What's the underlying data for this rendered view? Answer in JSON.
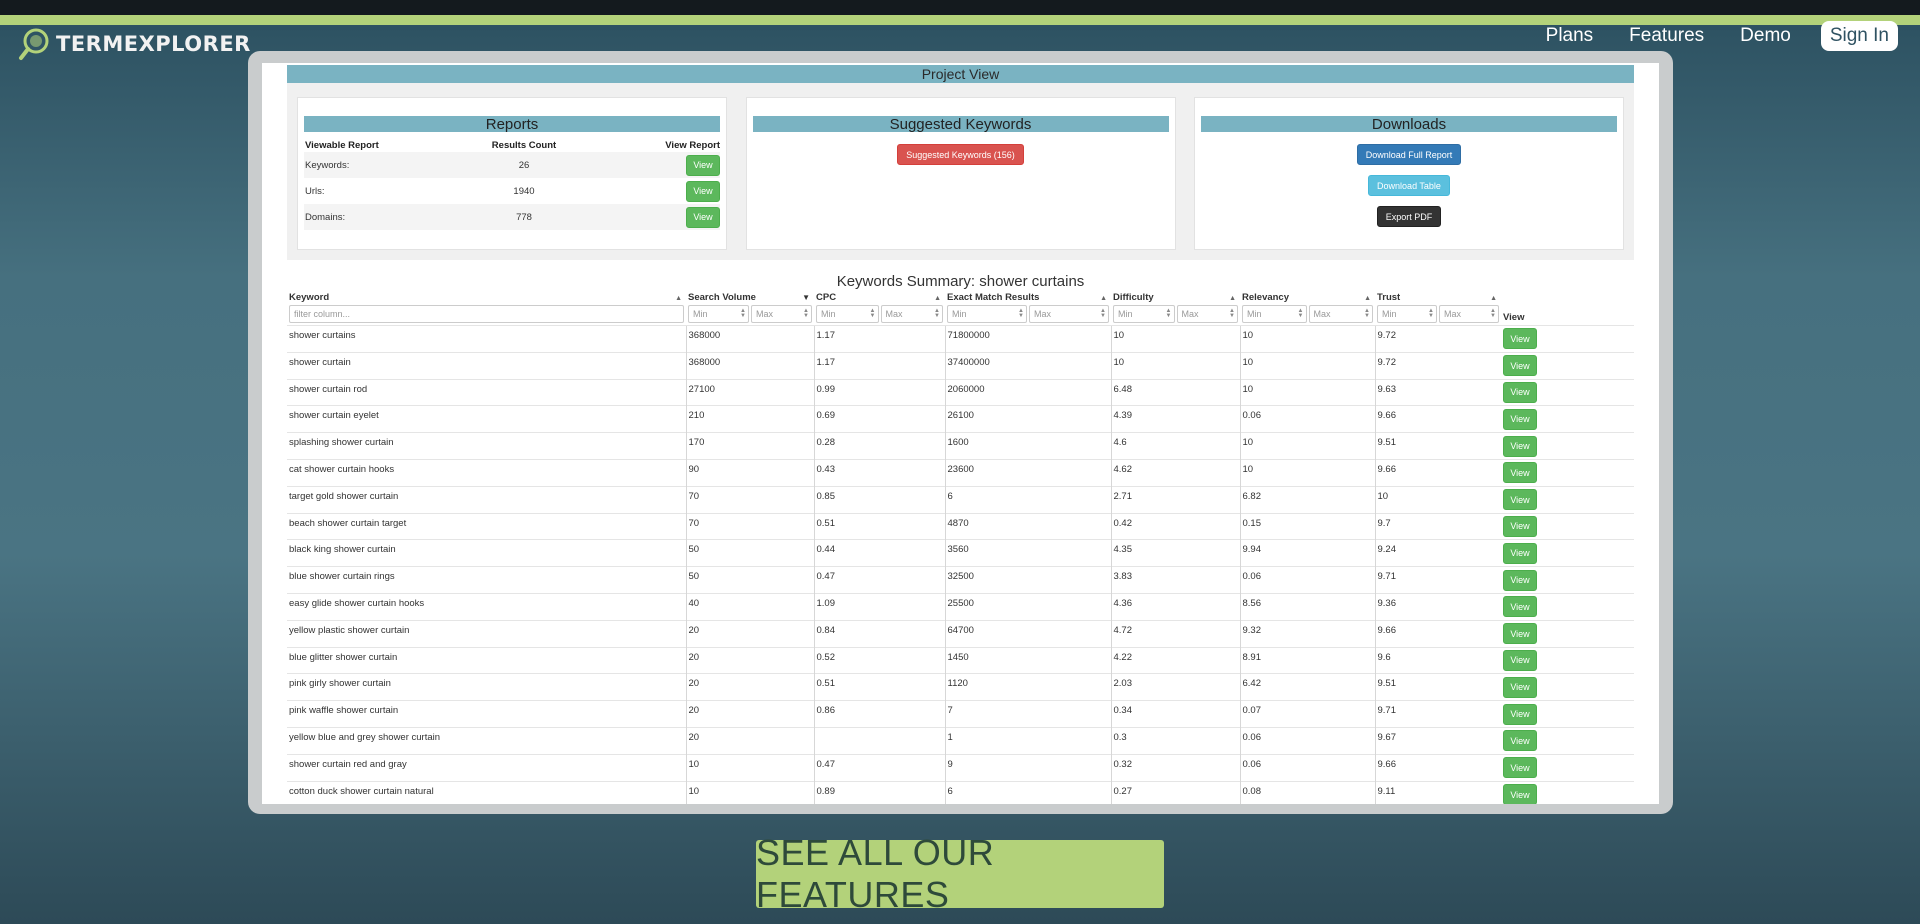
{
  "brand": {
    "logo_text": "TERMEXPLORER"
  },
  "nav": {
    "plans": "Plans",
    "features": "Features",
    "demo": "Demo",
    "sign_in": "Sign In"
  },
  "project_view": {
    "title": "Project View"
  },
  "reports": {
    "title": "Reports",
    "headers": [
      "Viewable Report",
      "Results Count",
      "View Report"
    ],
    "rows": [
      {
        "label": "Keywords:",
        "count": "26",
        "button": "View"
      },
      {
        "label": "Urls:",
        "count": "1940",
        "button": "View"
      },
      {
        "label": "Domains:",
        "count": "778",
        "button": "View"
      }
    ]
  },
  "suggested": {
    "title": "Suggested Keywords",
    "button": "Suggested Keywords (156)"
  },
  "downloads": {
    "title": "Downloads",
    "full_report": "Download Full Report",
    "table": "Download Table",
    "pdf": "Export PDF"
  },
  "summary": {
    "title": "Keywords Summary: shower curtains",
    "columns": [
      "Keyword",
      "Search Volume",
      "CPC",
      "Exact Match Results",
      "Difficulty",
      "Relevancy",
      "Trust",
      "View"
    ],
    "filter_placeholder": "filter column...",
    "min_placeholder": "Min",
    "max_placeholder": "Max",
    "view_label": "View",
    "rows": [
      [
        "shower curtains",
        "368000",
        "1.17",
        "71800000",
        "10",
        "10",
        "9.72"
      ],
      [
        "shower curtain",
        "368000",
        "1.17",
        "37400000",
        "10",
        "10",
        "9.72"
      ],
      [
        "shower curtain rod",
        "27100",
        "0.99",
        "2060000",
        "6.48",
        "10",
        "9.63"
      ],
      [
        "shower curtain eyelet",
        "210",
        "0.69",
        "26100",
        "4.39",
        "0.06",
        "9.66"
      ],
      [
        "splashing shower curtain",
        "170",
        "0.28",
        "1600",
        "4.6",
        "10",
        "9.51"
      ],
      [
        "cat shower curtain hooks",
        "90",
        "0.43",
        "23600",
        "4.62",
        "10",
        "9.66"
      ],
      [
        "target gold shower curtain",
        "70",
        "0.85",
        "6",
        "2.71",
        "6.82",
        "10"
      ],
      [
        "beach shower curtain target",
        "70",
        "0.51",
        "4870",
        "0.42",
        "0.15",
        "9.7"
      ],
      [
        "black king shower curtain",
        "50",
        "0.44",
        "3560",
        "4.35",
        "9.94",
        "9.24"
      ],
      [
        "blue shower curtain rings",
        "50",
        "0.47",
        "32500",
        "3.83",
        "0.06",
        "9.71"
      ],
      [
        "easy glide shower curtain hooks",
        "40",
        "1.09",
        "25500",
        "4.36",
        "8.56",
        "9.36"
      ],
      [
        "yellow plastic shower curtain",
        "20",
        "0.84",
        "64700",
        "4.72",
        "9.32",
        "9.66"
      ],
      [
        "blue glitter shower curtain",
        "20",
        "0.52",
        "1450",
        "4.22",
        "8.91",
        "9.6"
      ],
      [
        "pink girly shower curtain",
        "20",
        "0.51",
        "1120",
        "2.03",
        "6.42",
        "9.51"
      ],
      [
        "pink waffle shower curtain",
        "20",
        "0.86",
        "7",
        "0.34",
        "0.07",
        "9.71"
      ],
      [
        "yellow blue and grey shower curtain",
        "20",
        "",
        "1",
        "0.3",
        "0.06",
        "9.67"
      ],
      [
        "shower curtain red and gray",
        "10",
        "0.47",
        "9",
        "0.32",
        "0.06",
        "9.66"
      ],
      [
        "cotton duck shower curtain natural",
        "10",
        "0.89",
        "6",
        "0.27",
        "0.08",
        "9.11"
      ]
    ]
  },
  "cta": {
    "label": "SEE ALL OUR FEATURES"
  },
  "colors": {
    "accent_green": "#b3d27a",
    "header_blue": "#7ab3c2",
    "button_green": "#5cb85c"
  }
}
